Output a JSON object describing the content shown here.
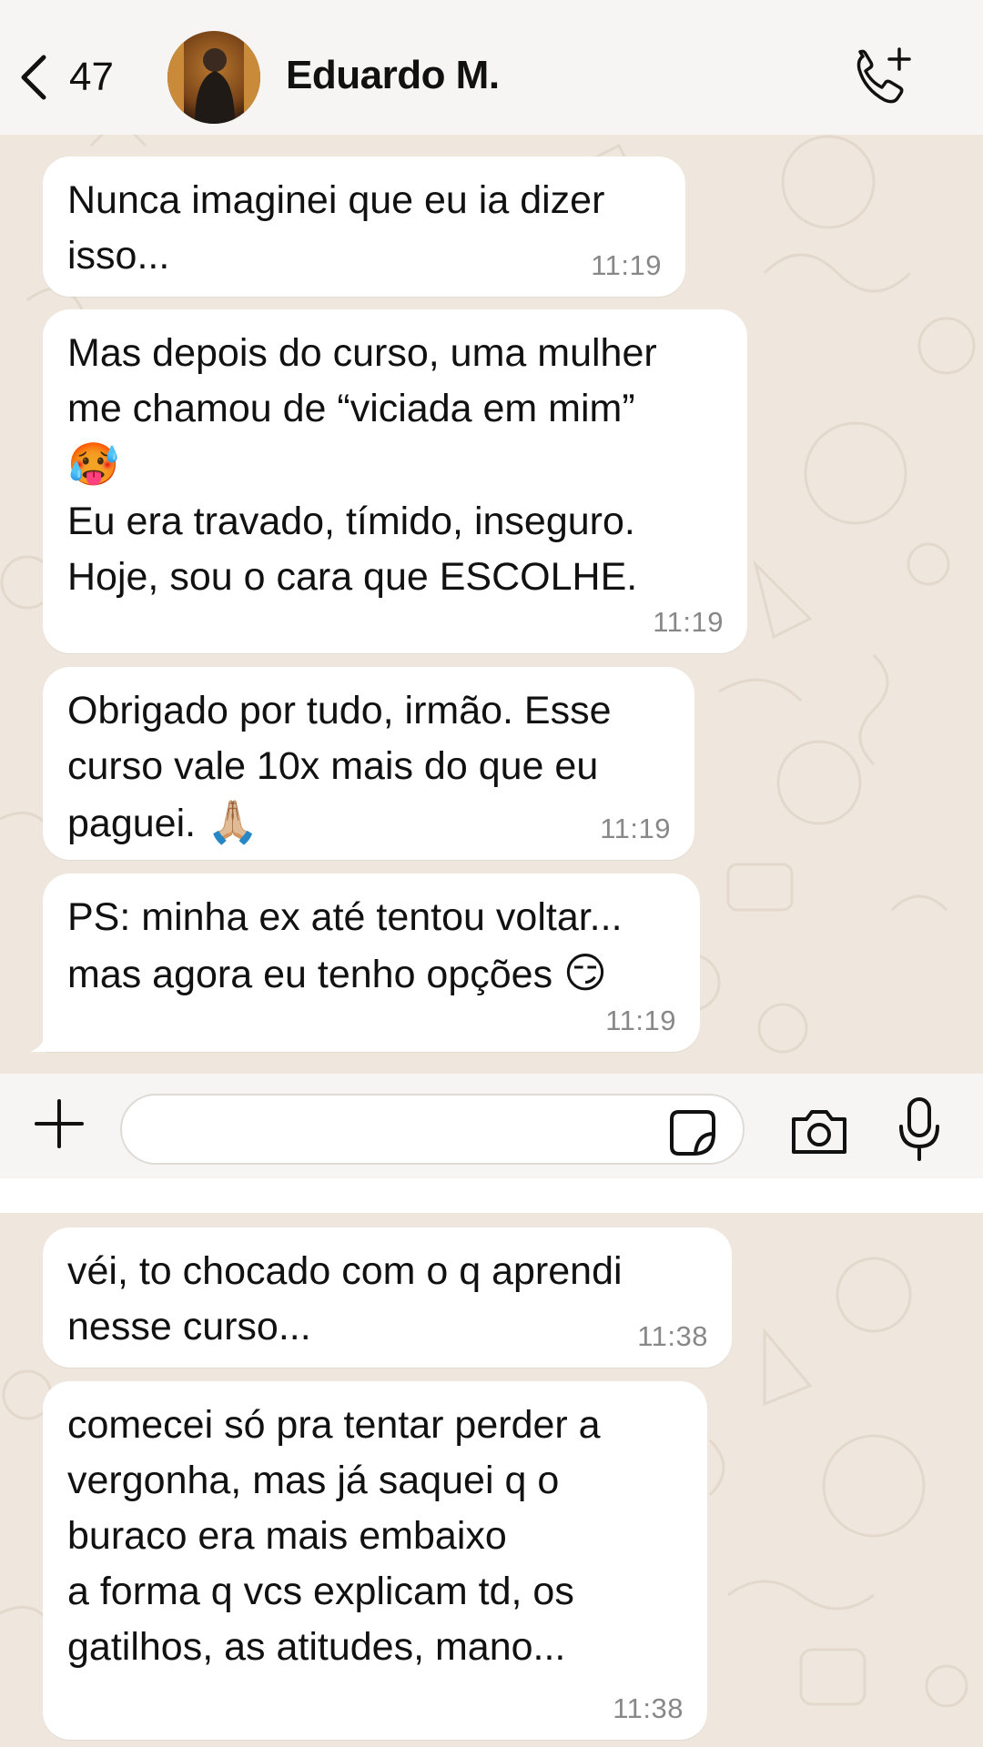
{
  "header": {
    "back_count": "47",
    "contact_name": "Eduardo M."
  },
  "screen_top": {
    "messages": [
      {
        "text": "Nunca imaginei que eu ia dizer\nisso...",
        "time": "11:19"
      },
      {
        "text_before": "Mas depois do curso, uma mulher\nme chamou de “viciada em mim”\n",
        "emoji": "🥵",
        "text_after": "\nEu era travado, tímido, inseguro.\nHoje, sou o cara que ESCOLHE.",
        "time": "11:19"
      },
      {
        "text": "Obrigado por tudo, irmão. Esse\ncurso vale 10x mais do que eu\npaguei. ",
        "emoji": "🙏🏼",
        "time": "11:19"
      },
      {
        "text": "PS: minha ex até tentou voltar...\nmas agora eu tenho opções ",
        "emoji": "😏",
        "time": "11:19"
      }
    ]
  },
  "input_bar": {
    "placeholder": ""
  },
  "screen_bottom": {
    "messages": [
      {
        "text": "véi, to chocado com o q aprendi\nnesse curso...",
        "time": "11:38"
      },
      {
        "text": "comecei só pra tentar perder a\nvergonha, mas já saquei q o\nburaco era mais embaixo\na forma q vcs explicam td, os\ngatilhos, as atitudes, mano...",
        "time": "11:38"
      }
    ]
  },
  "colors": {
    "wallpaper": "#efe7dd",
    "bubble_incoming": "#ffffff",
    "header_bg": "#f6f5f3",
    "timestamp": "#888888"
  },
  "icons": [
    "chevron-left-icon",
    "add-call-icon",
    "plus-icon",
    "sticker-icon",
    "camera-icon",
    "microphone-icon"
  ]
}
